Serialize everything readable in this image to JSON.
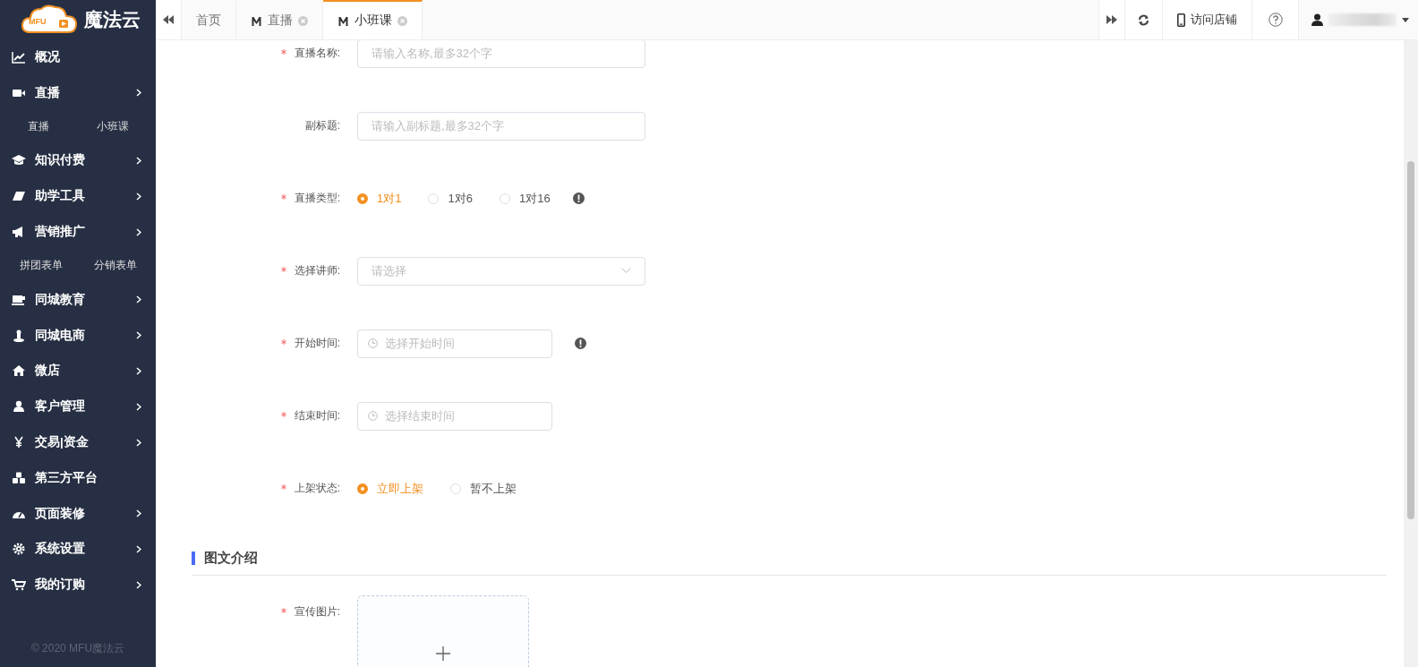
{
  "logo": {
    "badge": "MFU",
    "name": "魔法云"
  },
  "sidebar": {
    "items": [
      {
        "label": "概况",
        "has_submenu": false
      },
      {
        "label": "直播",
        "has_submenu": true,
        "children": [
          {
            "label": "直播"
          },
          {
            "label": "小班课"
          }
        ]
      },
      {
        "label": "知识付费",
        "has_submenu": true
      },
      {
        "label": "助学工具",
        "has_submenu": true
      },
      {
        "label": "营销推广",
        "has_submenu": true,
        "children": [
          {
            "label": "拼团表单"
          },
          {
            "label": "分销表单"
          }
        ]
      },
      {
        "label": "同城教育",
        "has_submenu": true
      },
      {
        "label": "同城电商",
        "has_submenu": true
      },
      {
        "label": "微店",
        "has_submenu": true
      },
      {
        "label": "客户管理",
        "has_submenu": true
      },
      {
        "label": "交易|资金",
        "has_submenu": true
      },
      {
        "label": "第三方平台",
        "has_submenu": false
      },
      {
        "label": "页面装修",
        "has_submenu": true
      },
      {
        "label": "系统设置",
        "has_submenu": true
      },
      {
        "label": "我的订购",
        "has_submenu": true
      }
    ],
    "footer": "© 2020 MFU魔法云"
  },
  "tabs": [
    {
      "label": "首页",
      "selected": false,
      "closable": false
    },
    {
      "label": "直播",
      "selected": false,
      "closable": true
    },
    {
      "label": "小班课",
      "selected": true,
      "closable": true
    }
  ],
  "toolbar": {
    "visit_store": "访问店铺"
  },
  "form": {
    "rows": [
      {
        "kind": "text",
        "label": "直播名称:",
        "required": true,
        "placeholder": "请输入名称,最多32个字",
        "hint_icon": false
      },
      {
        "kind": "text",
        "label": "副标题:",
        "required": false,
        "placeholder": "请输入副标题,最多32个字",
        "hint_icon": false
      },
      {
        "kind": "radio",
        "label": "直播类型:",
        "required": true,
        "hint_icon": true,
        "options": [
          {
            "label": "1对1",
            "selected": true
          },
          {
            "label": "1对6",
            "selected": false
          },
          {
            "label": "1对16",
            "selected": false
          }
        ]
      },
      {
        "kind": "select",
        "label": "选择讲师:",
        "required": true,
        "placeholder": "请选择",
        "hint_icon": false
      },
      {
        "kind": "time",
        "label": "开始时间:",
        "required": true,
        "placeholder": "选择开始时间",
        "hint_icon": true
      },
      {
        "kind": "time",
        "label": "结束时间:",
        "required": true,
        "placeholder": "选择结束时间",
        "hint_icon": false
      },
      {
        "kind": "radio",
        "label": "上架状态:",
        "required": true,
        "hint_icon": false,
        "options": [
          {
            "label": "立即上架",
            "selected": true
          },
          {
            "label": "暂不上架",
            "selected": false
          }
        ]
      }
    ],
    "section": {
      "title": "图文介绍"
    },
    "upload": {
      "label": "宣传图片:",
      "required": true
    }
  }
}
